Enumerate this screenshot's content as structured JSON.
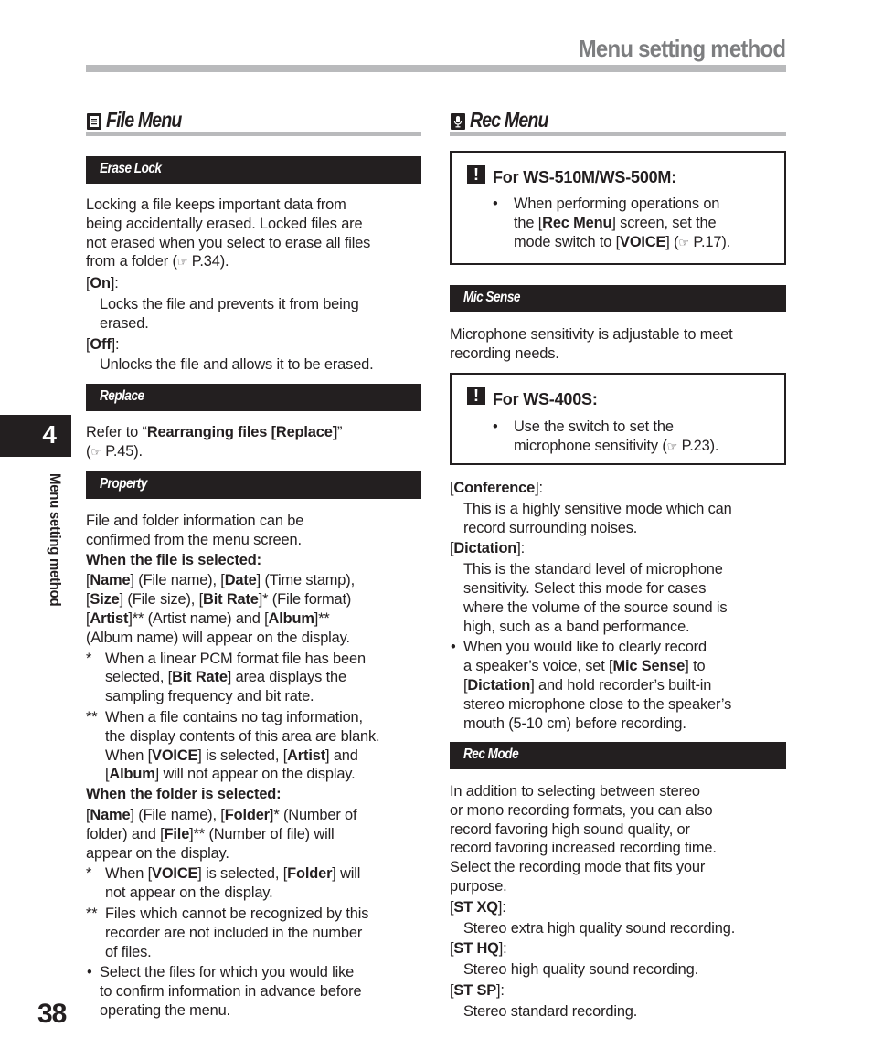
{
  "header": {
    "title": "Menu setting method"
  },
  "side": {
    "chapter_number": "4",
    "chapter_label": "Menu setting method"
  },
  "page_number": "38",
  "ref_glyph": "☞",
  "file_menu": {
    "title": "File Menu",
    "icon": "document-icon",
    "erase_lock": {
      "heading": "Erase Lock",
      "lines": [
        "Locking a file keeps important data from",
        "being accidentally erased. Locked files are",
        "not erased when you select to erase all files"
      ],
      "line4_pre": "from a folder (",
      "line4_ref": "P.34).",
      "on_label": "On",
      "on_desc": [
        "Locks the file and prevents it from being",
        "erased."
      ],
      "off_label": "Off",
      "off_desc": "Unlocks the file and allows it to be erased."
    },
    "replace": {
      "heading": "Replace",
      "pre": "Refer to “",
      "bold": "Rearranging files [Replace]",
      "post": "”",
      "ref": "P.45)."
    },
    "property": {
      "heading": "Property",
      "intro": [
        "File and folder information can be",
        "confirmed from the menu screen."
      ],
      "file_selected_heading": "When the file is selected:",
      "file_items": {
        "name": "Name",
        "name_desc": " (File name), [",
        "date": "Date",
        "date_desc": " (Time stamp),",
        "size": "Size",
        "size_desc": " (File size), [",
        "bitrate": "Bit Rate",
        "bitrate_desc": "* (File format)",
        "artist": "Artist",
        "artist_desc": "** (Artist name) and [",
        "album": "Album",
        "album_desc": "**",
        "last": "(Album name) will appear on the display."
      },
      "fn1_marker": "*",
      "fn1": [
        "When a linear PCM format file has been",
        "selected, [",
        "Bit Rate",
        "] area displays the",
        "sampling frequency and bit rate."
      ],
      "fn2_marker": "**",
      "fn2": [
        "When a file contains no tag information,",
        "the display contents of this area are blank.",
        "When [",
        "VOICE",
        "] is selected, [",
        "Artist",
        "] and",
        "Album",
        "] will not appear on the display."
      ],
      "folder_selected_heading": "When the folder is selected:",
      "folder_items": {
        "name": "Name",
        "name_desc": " (File name), [",
        "folder": "Folder",
        "folder_desc": "* (Number of",
        "line2_pre": "folder) and [",
        "file": "File",
        "file_desc": "** (Number of file) will",
        "last": "appear on the display."
      },
      "fn3_marker": "*",
      "fn3": [
        "When [",
        "VOICE",
        "] is selected, [",
        "Folder",
        "] will",
        "not appear on the display."
      ],
      "fn4_marker": "**",
      "fn4": [
        "Files which cannot be recognized by this",
        "recorder are not included in the number",
        "of files."
      ],
      "bullet": [
        "Select the files for which you would like",
        "to confirm information in advance before",
        "operating the menu."
      ]
    }
  },
  "rec_menu": {
    "title": "Rec Menu",
    "icon": "microphone-icon",
    "note1": {
      "icon": "!",
      "title": "For WS-510M/WS-500M:",
      "line1": "When performing operations on",
      "line2_pre": "the [",
      "line2_bold": "Rec Menu",
      "line2_post": "] screen, set the",
      "line3_pre": "mode switch to [",
      "line3_bold": "VOICE",
      "line3_post": "] (",
      "line3_ref": "P.17)."
    },
    "mic_sense": {
      "heading": "Mic Sense",
      "intro": [
        "Microphone sensitivity is adjustable to meet",
        "recording needs."
      ],
      "note2": {
        "icon": "!",
        "title": "For WS-400S:",
        "line1": "Use the switch to set the",
        "line2_pre": "microphone sensitivity (",
        "line2_ref": "P.23)."
      },
      "conference_label": "Conference",
      "conference_desc": [
        "This is a highly sensitive mode which can",
        "record surrounding noises."
      ],
      "dictation_label": "Dictation",
      "dictation_desc": [
        "This is the standard level of microphone",
        "sensitivity. Select this mode for cases",
        "where the volume of the source sound is",
        "high, such as a band performance."
      ],
      "tip": {
        "line1": "When you would like to clearly record",
        "line2_pre": "a speaker’s voice, set [",
        "line2_bold": "Mic Sense",
        "line2_post": "] to",
        "line3_bold": "Dictation",
        "line3_post": "] and hold recorder’s built-in",
        "line4": "stereo microphone close to the speaker’s",
        "line5": "mouth (5-10 cm) before recording."
      }
    },
    "rec_mode": {
      "heading": "Rec Mode",
      "intro": [
        "In addition to selecting between stereo",
        "or mono recording formats, you can also",
        "record favoring high sound quality, or",
        "record favoring increased recording time.",
        "Select the recording mode that fits your",
        "purpose."
      ],
      "modes": [
        {
          "label": "ST XQ",
          "desc": "Stereo extra high quality sound recording."
        },
        {
          "label": "ST HQ",
          "desc": "Stereo high quality sound recording."
        },
        {
          "label": "ST SP",
          "desc": "Stereo standard recording."
        }
      ]
    }
  }
}
